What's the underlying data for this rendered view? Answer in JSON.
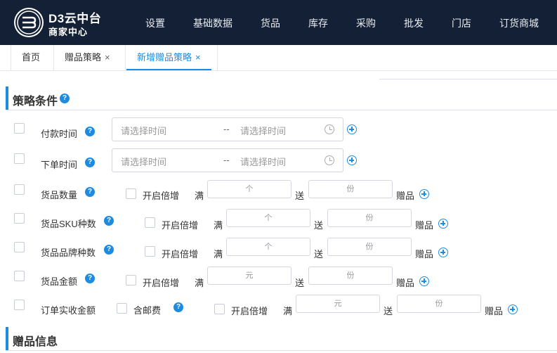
{
  "header": {
    "brand_main": "D3云中台",
    "brand_sub": "商家中心",
    "nav": [
      "设置",
      "基础数据",
      "货品",
      "库存",
      "采购",
      "批发",
      "门店",
      "订货商城"
    ]
  },
  "tabs": [
    {
      "label": "首页",
      "closable": false
    },
    {
      "label": "赠品策略",
      "closable": true,
      "close_glyph": "×"
    },
    {
      "label": "新增赠品策略",
      "closable": true,
      "active": true,
      "close_glyph": "×"
    }
  ],
  "sections": {
    "conditions_title": "策略条件",
    "gift_title": "赠品信息"
  },
  "help_glyph": "?",
  "conditions": {
    "pay_time": {
      "label": "付款时间",
      "start_placeholder": "请选择时间",
      "end_placeholder": "请选择时间",
      "separator": "--"
    },
    "order_time": {
      "label": "下单时间",
      "start_placeholder": "请选择时间",
      "end_placeholder": "请选择时间",
      "separator": "--"
    },
    "qty": {
      "label": "货品数量",
      "multiply": "开启倍增",
      "full": "满",
      "unit_placeholder": "个",
      "give": "送",
      "gift_placeholder": "份",
      "gift": "赠品"
    },
    "sku": {
      "label": "货品SKU种数",
      "multiply": "开启倍增",
      "full": "满",
      "unit_placeholder": "个",
      "give": "送",
      "gift_placeholder": "份",
      "gift": "赠品"
    },
    "brand": {
      "label": "货品品牌种数",
      "multiply": "开启倍增",
      "full": "满",
      "unit_placeholder": "个",
      "give": "送",
      "gift_placeholder": "份",
      "gift": "赠品"
    },
    "amount": {
      "label": "货品金额",
      "multiply": "开启倍增",
      "full": "满",
      "unit_placeholder": "元",
      "give": "送",
      "gift_placeholder": "份",
      "gift": "赠品"
    },
    "order_amount": {
      "label": "订单实收金额",
      "shipping": "含邮费",
      "multiply": "开启倍增",
      "full": "满",
      "unit_placeholder": "元",
      "give": "送",
      "gift_placeholder": "份",
      "gift": "赠品"
    }
  },
  "colors": {
    "header_bg": "#142035",
    "accent": "#1d8ce0"
  }
}
